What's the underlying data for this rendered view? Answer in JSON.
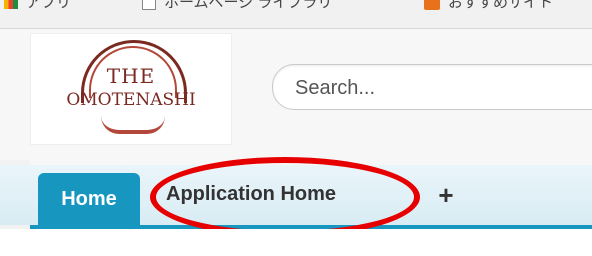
{
  "bookmarks": [
    {
      "icon": "apps-grid-icon",
      "label": "アプリ"
    },
    {
      "icon": "page-icon",
      "label": "ホームページ ライブラリ"
    },
    {
      "icon": "orange-bookmark-icon",
      "label": "おすすめサイト"
    }
  ],
  "logo": {
    "line1": "THE",
    "line2": "OMOTENASHI"
  },
  "search": {
    "placeholder": "Search..."
  },
  "tabs": {
    "home_label": "Home",
    "app_home_label": "Application Home",
    "add_label": "+"
  },
  "colors": {
    "tab_active": "#1797c0",
    "highlight": "#e60000",
    "logo_brown": "#7b2a22"
  }
}
